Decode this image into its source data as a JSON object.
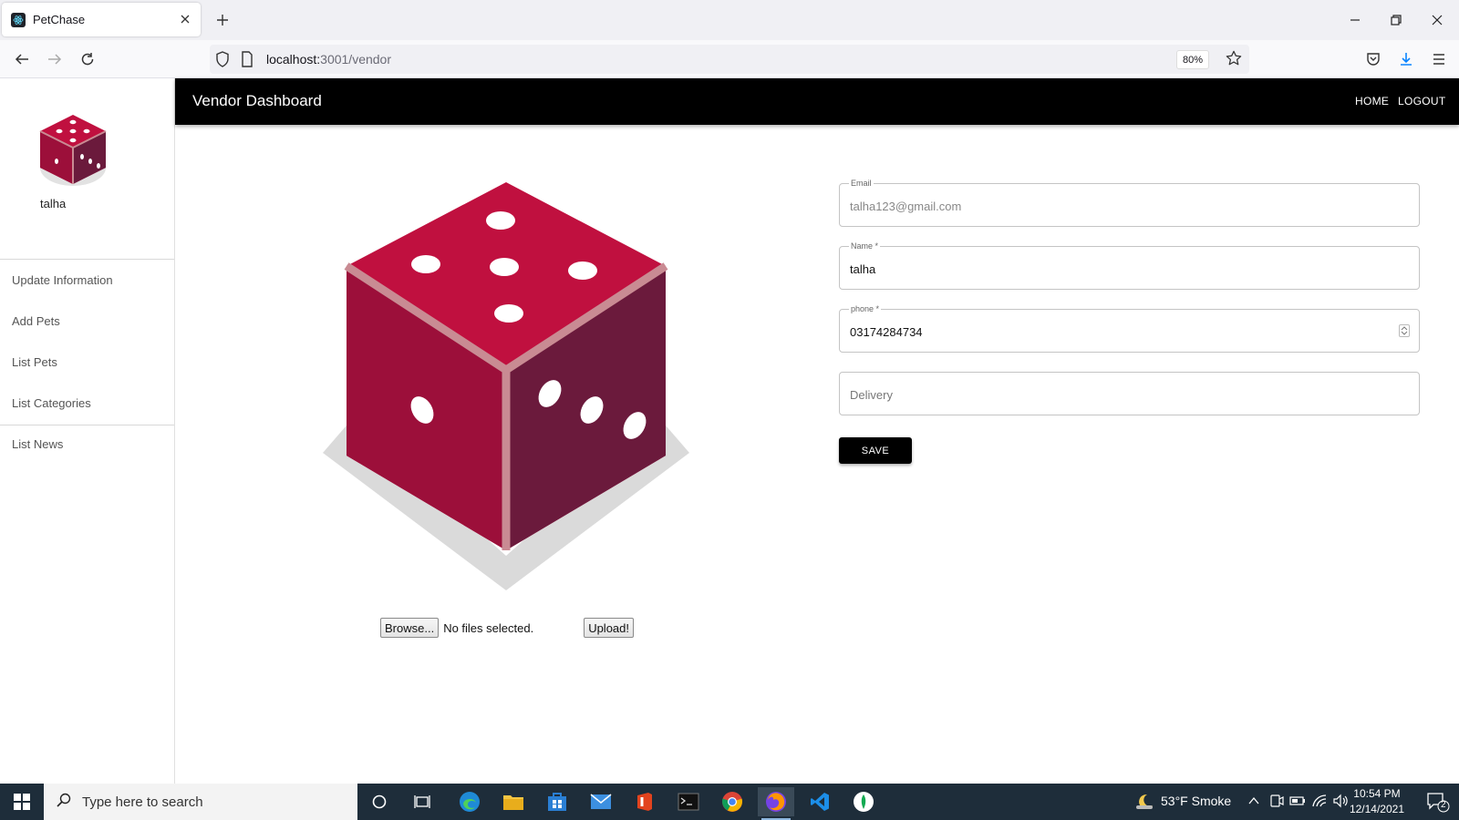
{
  "browser": {
    "tab_title": "PetChase",
    "url_host": "localhost:",
    "url_path": "3001/vendor",
    "zoom": "80%"
  },
  "sidebar": {
    "username": "talha",
    "items": [
      {
        "label": "Update Information"
      },
      {
        "label": "Add Pets"
      },
      {
        "label": "List Pets"
      },
      {
        "label": "List Categories"
      },
      {
        "label": "List News"
      }
    ]
  },
  "appbar": {
    "title": "Vendor Dashboard",
    "home_label": "HOME",
    "logout_label": "LOGOUT"
  },
  "upload": {
    "browse_label": "Browse...",
    "status_text": "No files selected.",
    "upload_label": "Upload!"
  },
  "form": {
    "email": {
      "label": "Email",
      "value": "talha123@gmail.com"
    },
    "name": {
      "label": "Name *",
      "value": "talha"
    },
    "phone": {
      "label": "phone *",
      "value": "03174284734"
    },
    "delivery": {
      "placeholder": "Delivery"
    },
    "save_label": "SAVE"
  },
  "taskbar": {
    "search_placeholder": "Type here to search",
    "weather": "53°F  Smoke",
    "time": "10:54 PM",
    "date": "12/14/2021",
    "notification_count": "2"
  },
  "colors": {
    "dice_top": "#c0103f",
    "dice_left": "#9c0f3a",
    "dice_right": "#6b1a3c",
    "appbar": "#000000",
    "taskbar": "#1e2d3a"
  }
}
